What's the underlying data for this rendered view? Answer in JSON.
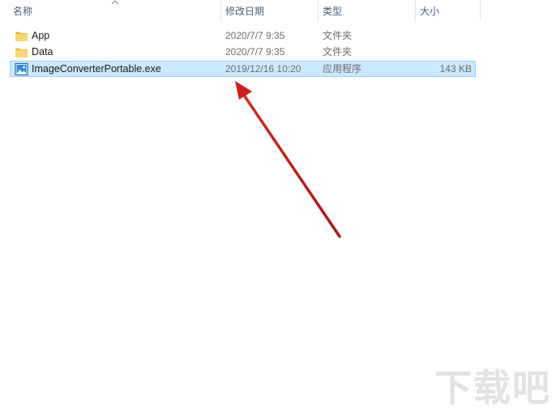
{
  "columns": {
    "name": "名称",
    "date": "修改日期",
    "type": "类型",
    "size": "大小"
  },
  "files": [
    {
      "name": "App",
      "date": "2020/7/7 9:35",
      "type": "文件夹",
      "size": "",
      "icon": "folder-icon",
      "selected": false
    },
    {
      "name": "Data",
      "date": "2020/7/7 9:35",
      "type": "文件夹",
      "size": "",
      "icon": "folder-icon",
      "selected": false
    },
    {
      "name": "ImageConverterPortable.exe",
      "date": "2019/12/16 10:20",
      "type": "应用程序",
      "size": "143 KB",
      "icon": "image-app-icon",
      "selected": true
    }
  ],
  "colors": {
    "selection_bg": "#cce8ff",
    "selection_border": "#99d1ff",
    "folder": "#f8d775",
    "arrow": "#c8201e"
  },
  "watermark": "下载吧"
}
